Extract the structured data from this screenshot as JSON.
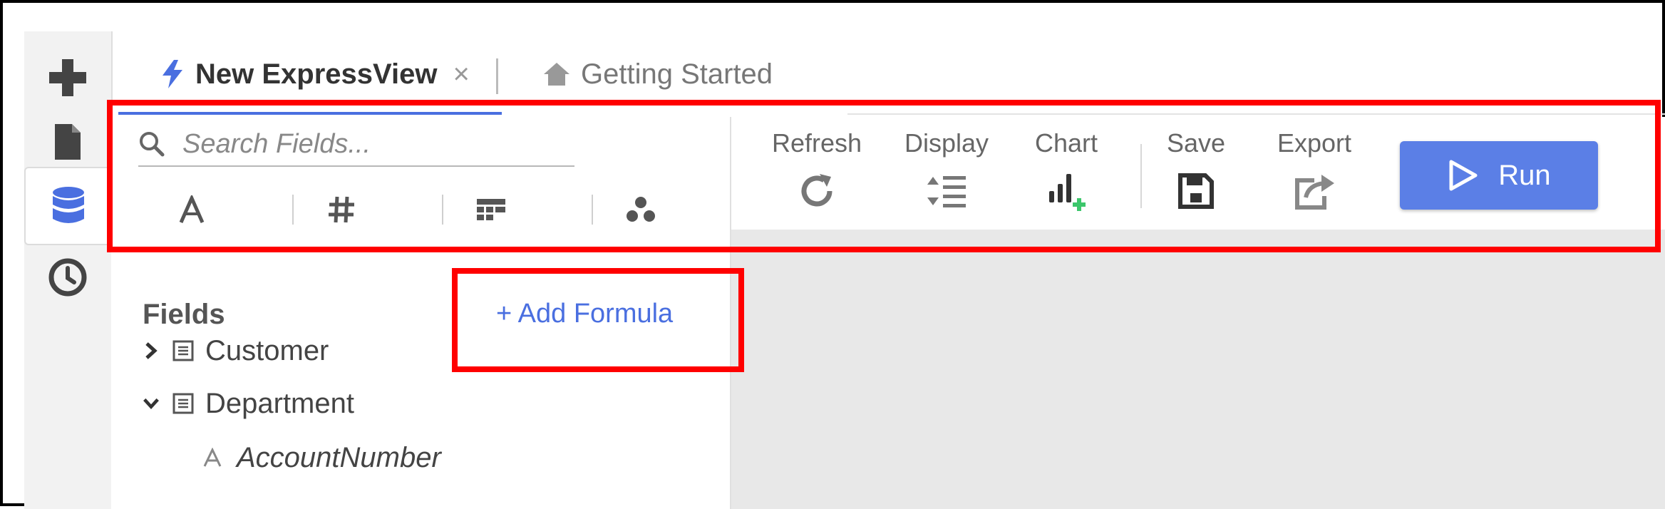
{
  "tabs": [
    {
      "label": "New ExpressView",
      "close": "×"
    },
    {
      "label": "Getting Started"
    }
  ],
  "search": {
    "placeholder": "Search Fields..."
  },
  "fields_panel": {
    "title": "Fields",
    "add_formula": "+ Add Formula",
    "tree": [
      {
        "label": "Customer",
        "expanded": false
      },
      {
        "label": "Department",
        "expanded": true,
        "children": [
          "AccountNumber"
        ]
      }
    ]
  },
  "toolbar": {
    "refresh": "Refresh",
    "display": "Display",
    "chart": "Chart",
    "save": "Save",
    "export": "Export",
    "run": "Run"
  },
  "colors": {
    "accent": "#4a6fe0",
    "run_button": "#5b7fe6",
    "highlight": "#ff0000",
    "chart_plus": "#3cc66b"
  }
}
